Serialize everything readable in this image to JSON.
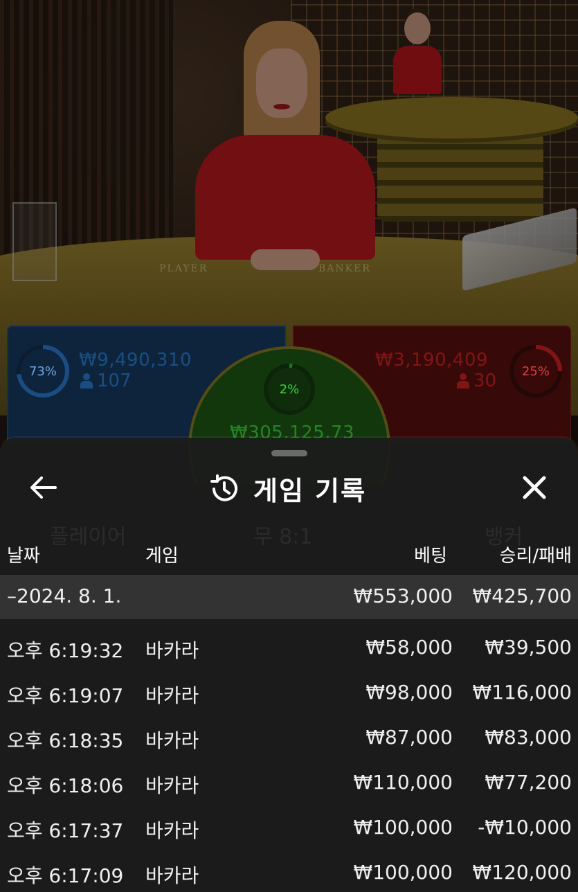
{
  "stream": {
    "table_labels": {
      "player": "PLAYER",
      "banker": "BANKER"
    }
  },
  "bets": {
    "player": {
      "percent_label": "73%",
      "amount": "₩9,490,310",
      "players": "107",
      "color": "#2a7fd4"
    },
    "banker": {
      "percent_label": "25%",
      "amount": "₩3,190,409",
      "players": "30",
      "color": "#d02222"
    },
    "tie": {
      "percent_label": "2%",
      "amount": "₩305,125.73",
      "color": "#2fbf2f"
    }
  },
  "sheet": {
    "title": "게임 기록",
    "back_icon": "arrow-left-icon",
    "history_icon": "history-clock-icon",
    "close_icon": "close-icon",
    "columns": {
      "date": "날짜",
      "game": "게임",
      "bet": "베팅",
      "result": "승리/패배"
    },
    "summary": {
      "date": "–2024. 8. 1.",
      "bet": "₩553,000",
      "result": "₩425,700"
    },
    "rows": [
      {
        "time": "오후 6:19:32",
        "game": "바카라",
        "bet": "₩58,000",
        "result": "₩39,500"
      },
      {
        "time": "오후 6:19:07",
        "game": "바카라",
        "bet": "₩98,000",
        "result": "₩116,000"
      },
      {
        "time": "오후 6:18:35",
        "game": "바카라",
        "bet": "₩87,000",
        "result": "₩83,000"
      },
      {
        "time": "오후 6:18:06",
        "game": "바카라",
        "bet": "₩110,000",
        "result": "₩77,200"
      },
      {
        "time": "오후 6:17:37",
        "game": "바카라",
        "bet": "₩100,000",
        "result": "-₩10,000"
      },
      {
        "time": "오후 6:17:09",
        "game": "바카라",
        "bet": "₩100,000",
        "result": "₩120,000"
      }
    ]
  },
  "background_ghost": {
    "player": "플레이어",
    "tie": "무 8:1",
    "banker": "뱅커"
  }
}
